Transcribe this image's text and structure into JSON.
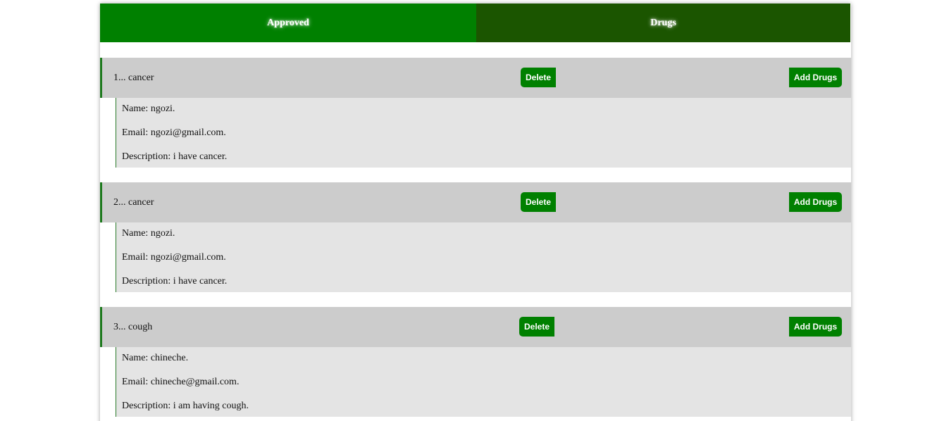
{
  "tabs": [
    {
      "label": "Approved"
    },
    {
      "label": "Drugs"
    }
  ],
  "entries": [
    {
      "title": "1... cancer",
      "delete_label": "Delete",
      "add_label": "Add Drugs",
      "name": "Name: ngozi.",
      "email": "Email: ngozi@gmail.com.",
      "description": "Description: i have cancer."
    },
    {
      "title": "2... cancer",
      "delete_label": "Delete",
      "add_label": "Add Drugs",
      "name": "Name: ngozi.",
      "email": "Email: ngozi@gmail.com.",
      "description": "Description: i have cancer."
    },
    {
      "title": "3... cough",
      "delete_label": "Delete",
      "add_label": "Add Drugs",
      "name": "Name: chineche.",
      "email": "Email: chineche@gmail.com.",
      "description": "Description: i am having cough."
    }
  ],
  "colors": {
    "tab_active": "#008000",
    "tab_inactive": "#1b5500",
    "button": "#008000",
    "header_bg": "#cccccc",
    "body_bg": "#e4e4e4"
  }
}
